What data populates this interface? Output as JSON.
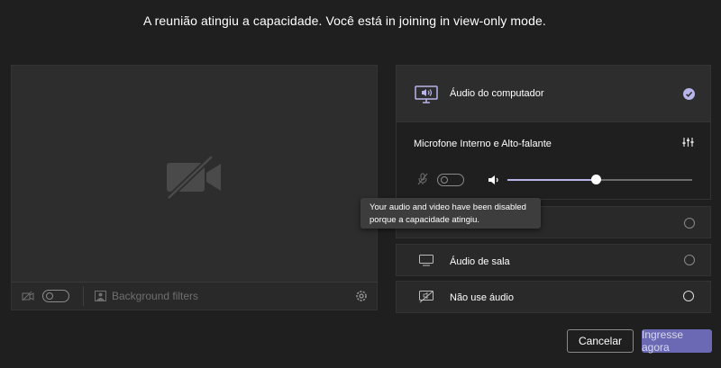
{
  "header": {
    "message": "A reunião atingiu a capacidade. Você está in joining in view-only mode."
  },
  "video": {
    "background_filters_label": "Background filters",
    "camera_toggle_on": false
  },
  "audio_options": {
    "computer_audio": {
      "label": "Áudio do computador",
      "selected": true
    },
    "device_label": "Microfone Interno e Alto-falante",
    "mic_toggle_on": false,
    "volume_level": 0.48,
    "room_audio": {
      "label": "Áudio de sala",
      "selected": false
    },
    "no_audio": {
      "label": "Não use áudio",
      "selected": false
    }
  },
  "tooltip": {
    "line1": "Your audio and video have been disabled",
    "line2": "porque a capacidade atingiu."
  },
  "actions": {
    "cancel_label": "Cancelar",
    "join_label": "Ingresse agora"
  },
  "colors": {
    "accent": "#6b69b3",
    "check": "#b8b5ea",
    "background": "#1f1f1f"
  }
}
